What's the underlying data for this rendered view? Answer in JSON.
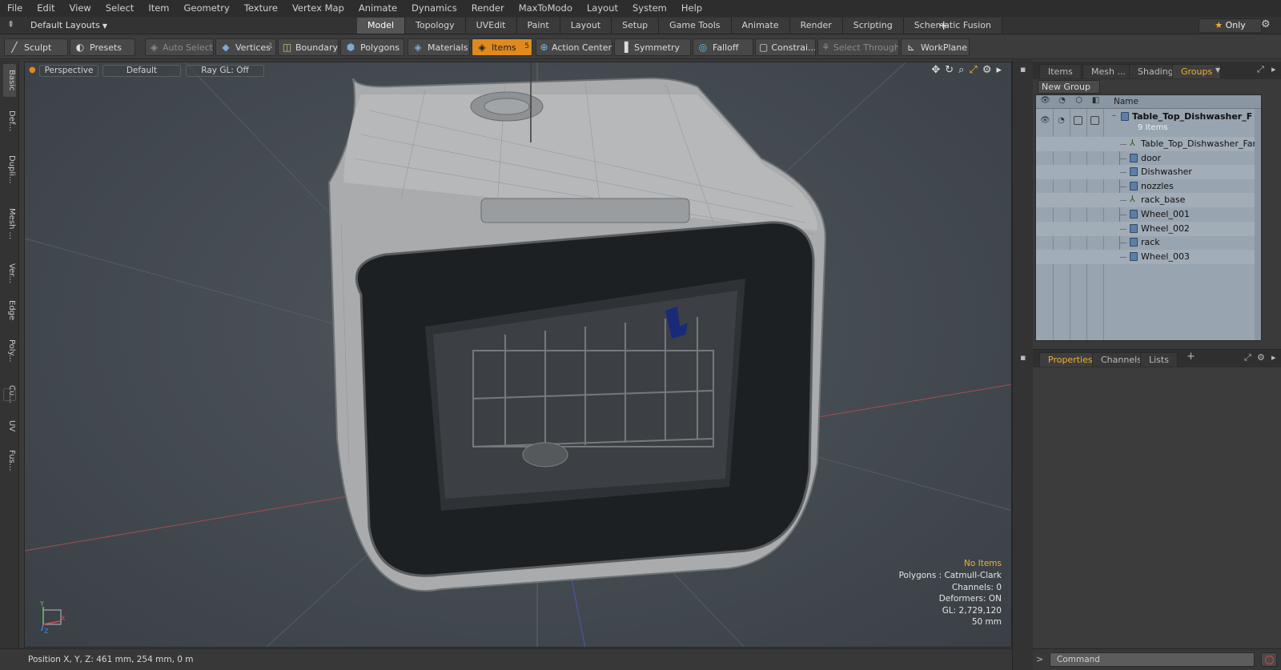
{
  "menu": [
    "File",
    "Edit",
    "View",
    "Select",
    "Item",
    "Geometry",
    "Texture",
    "Vertex Map",
    "Animate",
    "Dynamics",
    "Render",
    "MaxToModo",
    "Layout",
    "System",
    "Help"
  ],
  "layout": {
    "selector": "Default Layouts",
    "tabs": [
      "Model",
      "Topology",
      "UVEdit",
      "Paint",
      "Layout",
      "Setup",
      "Game Tools",
      "Animate",
      "Render",
      "Scripting",
      "Schematic Fusion"
    ],
    "active_tab": "Model",
    "add_tab": "+",
    "only_label": "Only"
  },
  "toolbar": {
    "sculpt": "Sculpt",
    "presets": "Presets",
    "auto_select": "Auto Select",
    "vertices": "Vertices",
    "vertices_count": "1",
    "boundary": "Boundary",
    "polygons": "Polygons",
    "materials": "Materials",
    "items": "Items",
    "items_count": "5",
    "action_center": "Action Center",
    "symmetry": "Symmetry",
    "falloff": "Falloff",
    "constraints": "Constrai...",
    "select_through": "Select Through",
    "workplane": "WorkPlane"
  },
  "left_tabs": [
    "Basic",
    "Def...",
    "Dupli...",
    "Mesh ...",
    "Ver...",
    "Edge",
    "Poly...",
    "Cu...",
    "UV",
    "Fus..."
  ],
  "viewport": {
    "view_mode": "Perspective",
    "shading": "Default",
    "raygl": "Ray GL: Off",
    "stats": {
      "selection": "No Items",
      "polygons": "Polygons : Catmull-Clark",
      "channels": "Channels: 0",
      "deformers": "Deformers: ON",
      "gl": "GL: 2,729,120",
      "scale": "50 mm"
    },
    "axis": {
      "x": "X",
      "y": "Y",
      "z": "Z"
    }
  },
  "status": {
    "position": "Position X, Y, Z:  461 mm, 254 mm, 0 m"
  },
  "items_panel": {
    "tabs": [
      "Items",
      "Mesh ...",
      "Shading",
      "Groups"
    ],
    "active_tab": "Groups",
    "new_group": "New Group",
    "column_name": "Name",
    "root": {
      "name": "Table_Top_Dishwasher_F ...",
      "count": "9 Items"
    },
    "children": [
      {
        "name": "Table_Top_Dishwasher_Far ...",
        "icon": "locator-icon"
      },
      {
        "name": "door",
        "icon": "mesh-icon"
      },
      {
        "name": "Dishwasher",
        "icon": "mesh-icon"
      },
      {
        "name": "nozzles",
        "icon": "mesh-icon"
      },
      {
        "name": "rack_base",
        "icon": "locator-icon"
      },
      {
        "name": "Wheel_001",
        "icon": "mesh-icon"
      },
      {
        "name": "Wheel_002",
        "icon": "mesh-icon"
      },
      {
        "name": "rack",
        "icon": "mesh-icon"
      },
      {
        "name": "Wheel_003",
        "icon": "mesh-icon"
      }
    ]
  },
  "properties_panel": {
    "tabs": [
      "Properties",
      "Channels",
      "Lists"
    ],
    "active_tab": "Properties",
    "add_tab": "+"
  },
  "command": {
    "placeholder": "Command"
  },
  "colors": {
    "accent": "#e08a1e",
    "active_tab_text": "#f0b030",
    "tree_bg": "#98a4b0",
    "viewport_bg": "#4a5056"
  }
}
